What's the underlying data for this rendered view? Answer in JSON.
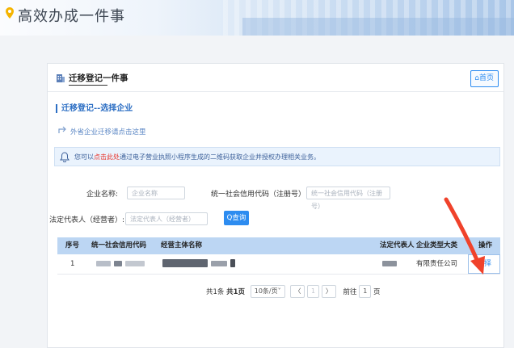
{
  "header": {
    "title": "高效办成一件事"
  },
  "card": {
    "title": "迁移登记一件事",
    "home_label": "首页"
  },
  "section": {
    "title": "迁移登记--选择企业"
  },
  "link": {
    "text": "外省企业迁移请点击这里"
  },
  "notice": {
    "prefix": "您可以",
    "link": "点击此处",
    "suffix": "通过电子营业执照小程序生成的二维码获取企业并授权办理相关业务。"
  },
  "form": {
    "company_label": "企业名称:",
    "company_placeholder": "企业名称",
    "code_label": "统一社会信用代码（注册号）:",
    "code_placeholder": "统一社会信用代码（注册号）",
    "rep_label": "法定代表人（经营者）:",
    "rep_placeholder": "法定代表人（经营者）",
    "query_label": "Q查询"
  },
  "table": {
    "headers": [
      "序号",
      "统一社会信用代码",
      "经营主体名称",
      "法定代表人",
      "企业类型大类",
      "操作"
    ],
    "rows": [
      {
        "index": "1",
        "type": "有限责任公司",
        "action": "选择"
      }
    ]
  },
  "pager": {
    "total_prefix": "共1条",
    "pages": "共1页",
    "page_size": "10条/页",
    "prev": "〈",
    "current": "1",
    "next": "〉",
    "goto_label": "前往",
    "goto_value": "1",
    "goto_suffix": "页"
  },
  "colors": {
    "accent": "#2d8cf0",
    "header_row": "#bcd6f3",
    "notice_bg": "#eaf3fd",
    "arrow": "#f0422b"
  }
}
